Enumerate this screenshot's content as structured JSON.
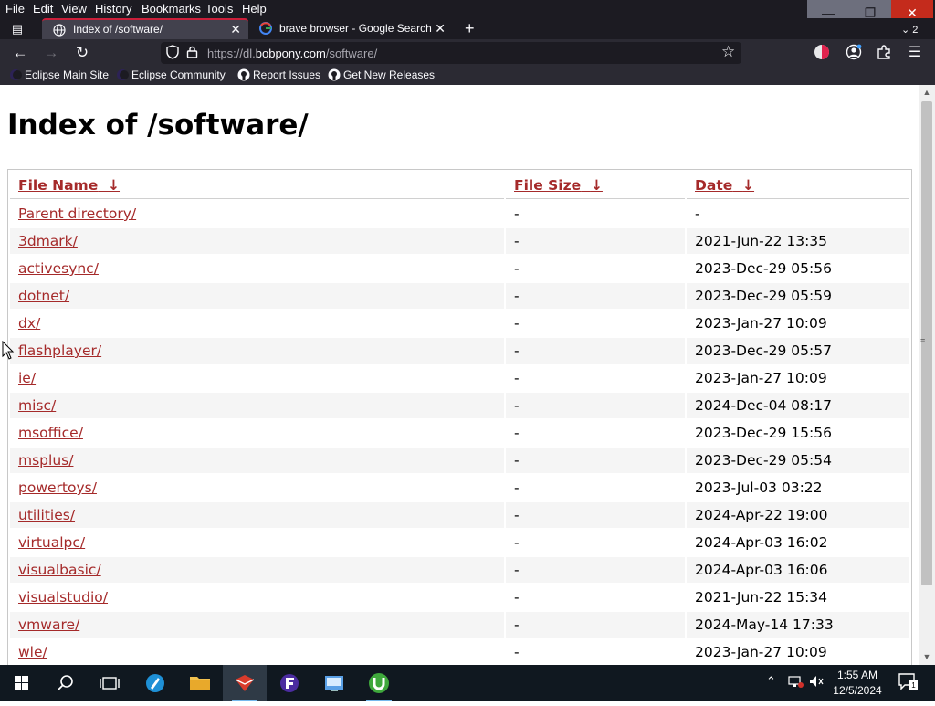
{
  "browser": {
    "menu": [
      "File",
      "Edit",
      "View",
      "History",
      "Bookmarks",
      "Tools",
      "Help"
    ],
    "tabs": [
      {
        "title": "Index of /software/",
        "active": true
      },
      {
        "title": "brave browser - Google Search",
        "active": false
      }
    ],
    "tabs_overflow": "2",
    "url": {
      "prefix": "https://dl.",
      "domain": "bobpony.com",
      "path": "/software/"
    },
    "bookmarks": [
      {
        "label": "Eclipse Main Site",
        "icon": "eclipse-icon"
      },
      {
        "label": "Eclipse Community",
        "icon": "eclipse-icon"
      },
      {
        "label": "Report Issues",
        "icon": "github-icon"
      },
      {
        "label": "Get New Releases",
        "icon": "github-icon"
      }
    ]
  },
  "page": {
    "title": "Index of /software/",
    "headers": {
      "name": "File Name",
      "size": "File Size",
      "date": "Date",
      "sort_arrow": "↓"
    },
    "rows": [
      {
        "name": "Parent directory/",
        "size": "-",
        "date": "-"
      },
      {
        "name": "3dmark/",
        "size": "-",
        "date": "2021-Jun-22 13:35"
      },
      {
        "name": "activesync/",
        "size": "-",
        "date": "2023-Dec-29 05:56"
      },
      {
        "name": "dotnet/",
        "size": "-",
        "date": "2023-Dec-29 05:59"
      },
      {
        "name": "dx/",
        "size": "-",
        "date": "2023-Jan-27 10:09"
      },
      {
        "name": "flashplayer/",
        "size": "-",
        "date": "2023-Dec-29 05:57"
      },
      {
        "name": "ie/",
        "size": "-",
        "date": "2023-Jan-27 10:09"
      },
      {
        "name": "misc/",
        "size": "-",
        "date": "2024-Dec-04 08:17"
      },
      {
        "name": "msoffice/",
        "size": "-",
        "date": "2023-Dec-29 15:56"
      },
      {
        "name": "msplus/",
        "size": "-",
        "date": "2023-Dec-29 05:54"
      },
      {
        "name": "powertoys/",
        "size": "-",
        "date": "2023-Jul-03 03:22"
      },
      {
        "name": "utilities/",
        "size": "-",
        "date": "2024-Apr-22 19:00"
      },
      {
        "name": "virtualpc/",
        "size": "-",
        "date": "2024-Apr-03 16:02"
      },
      {
        "name": "visualbasic/",
        "size": "-",
        "date": "2024-Apr-03 16:06"
      },
      {
        "name": "visualstudio/",
        "size": "-",
        "date": "2021-Jun-22 15:34"
      },
      {
        "name": "vmware/",
        "size": "-",
        "date": "2024-May-14 17:33"
      },
      {
        "name": "wle/",
        "size": "-",
        "date": "2023-Jan-27 10:09"
      }
    ]
  },
  "taskbar": {
    "apps": [
      "windows-start-icon",
      "search-icon",
      "task-view-icon",
      "browser-app-icon",
      "file-explorer-icon",
      "pdf-app-icon",
      "ftp-client-icon",
      "control-panel-icon",
      "utorrent-icon"
    ],
    "clock_time": "1:55 AM",
    "clock_date": "12/5/2024",
    "notifications": "1"
  },
  "colors": {
    "link": "#a52a2a",
    "chrome_bg": "#1c1b22",
    "active_tab_accent": "#cc1f3a"
  }
}
